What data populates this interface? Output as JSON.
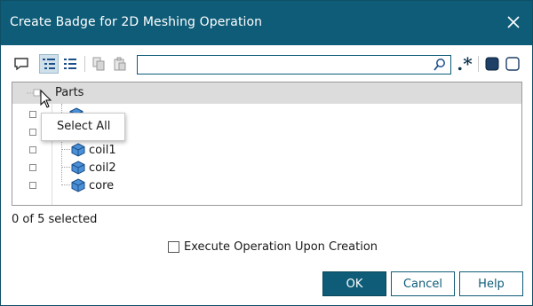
{
  "window": {
    "title": "Create Badge for 2D Meshing Operation"
  },
  "toolbar": {
    "icons": [
      "comment-icon",
      "tree-view-icon",
      "list-view-icon",
      "copy-icon",
      "paste-icon",
      "regex-icon",
      "select-all-square-icon",
      "deselect-square-icon"
    ],
    "regex_label": ".*",
    "active": "tree-view-icon"
  },
  "search": {
    "value": "",
    "placeholder": ""
  },
  "tree": {
    "header_label": "Parts",
    "items": [
      {
        "label": ""
      },
      {
        "label": ""
      },
      {
        "label": "coil1"
      },
      {
        "label": "coil2"
      },
      {
        "label": "core"
      }
    ]
  },
  "context_menu": {
    "item": "Select All"
  },
  "status": {
    "selected_text": "0 of 5 selected"
  },
  "options": {
    "execute_label": "Execute Operation Upon Creation",
    "execute_checked": false
  },
  "buttons": {
    "ok": "OK",
    "cancel": "Cancel",
    "help": "Help"
  },
  "colors": {
    "accent": "#0e5c78",
    "header_bg": "#dcdcdc"
  }
}
